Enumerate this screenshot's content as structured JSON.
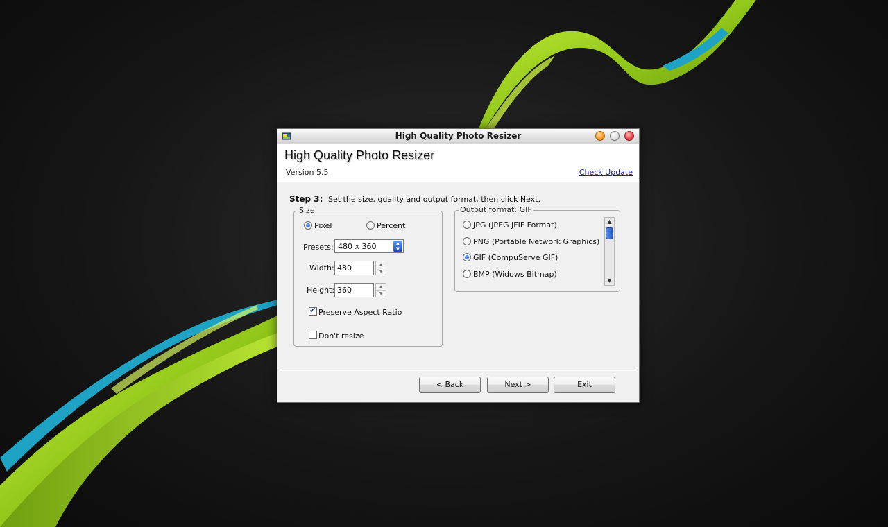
{
  "window": {
    "title": "High Quality Photo Resizer"
  },
  "header": {
    "title": "High Quality Photo Resizer",
    "version": "Version 5.5",
    "check_update": "Check Update"
  },
  "step": {
    "label": "Step 3:",
    "description": "Set the size, quality and output format, then click Next."
  },
  "size_group": {
    "legend": "Size",
    "mode_pixel": "Pixel",
    "mode_percent": "Percent",
    "selected_mode": "Pixel",
    "presets_label": "Presets:",
    "presets_value": "480 x 360",
    "width_label": "Width:",
    "width_value": "480",
    "height_label": "Height:",
    "height_value": "360",
    "preserve_label": "Preserve Aspect Ratio",
    "preserve_checked": true,
    "dont_resize_label": "Don't resize",
    "dont_resize_checked": false
  },
  "format_group": {
    "legend": "Output format: GIF",
    "options": [
      {
        "label": "JPG (JPEG JFIF Format)",
        "checked": false
      },
      {
        "label": "PNG (Portable Network Graphics)",
        "checked": false
      },
      {
        "label": "GIF (CompuServe GIF)",
        "checked": true
      },
      {
        "label": "BMP (Widows Bitmap)",
        "checked": false
      }
    ]
  },
  "buttons": {
    "back": "< Back",
    "next": "Next >",
    "exit": "Exit"
  },
  "colors": {
    "wallpaper": "#141414",
    "swoosh_green": "#9bd11e",
    "swoosh_cyan": "#1fa3c4",
    "link": "#1a1aa8",
    "radio_accent": "#1a4fb4"
  }
}
